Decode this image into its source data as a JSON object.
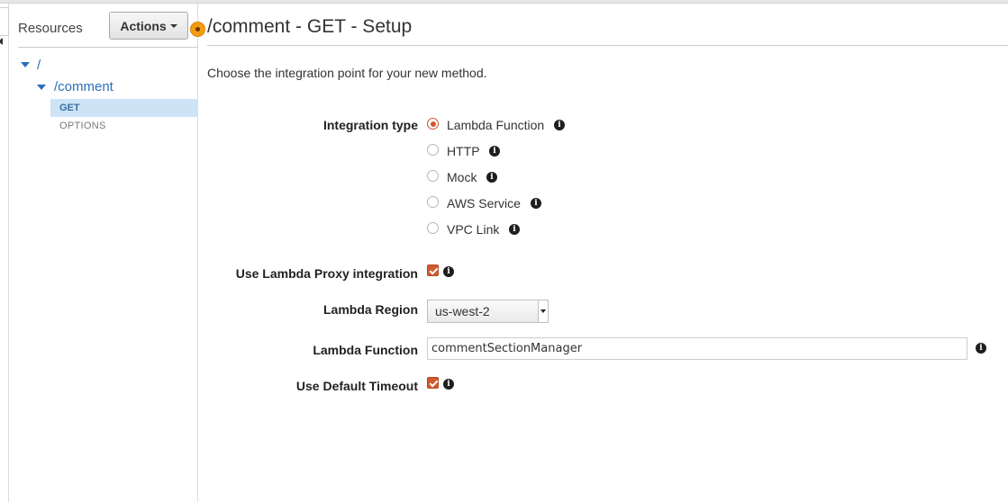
{
  "resources": {
    "title": "Resources",
    "actions_label": "Actions",
    "tree": {
      "root": "/",
      "child": "/comment",
      "methods": [
        "GET",
        "OPTIONS"
      ],
      "selected_method": "GET"
    }
  },
  "main": {
    "title": "/comment - GET - Setup",
    "intro": "Choose the integration point for your new method."
  },
  "form": {
    "integration_type_label": "Integration type",
    "integration_options": [
      {
        "label": "Lambda Function",
        "checked": true
      },
      {
        "label": "HTTP",
        "checked": false
      },
      {
        "label": "Mock",
        "checked": false
      },
      {
        "label": "AWS Service",
        "checked": false
      },
      {
        "label": "VPC Link",
        "checked": false
      }
    ],
    "proxy_label": "Use Lambda Proxy integration",
    "proxy_checked": true,
    "region_label": "Lambda Region",
    "region_value": "us-west-2",
    "function_label": "Lambda Function",
    "function_value": "commentSectionManager",
    "timeout_label": "Use Default Timeout",
    "timeout_checked": true
  },
  "colors": {
    "accent": "#d15a2d",
    "link": "#2a6ebb",
    "selected_bg": "#cfe3f6",
    "handle": "#f39c12"
  },
  "icons": {
    "info": "info-circle-icon",
    "toggle": "caret-down-icon"
  }
}
